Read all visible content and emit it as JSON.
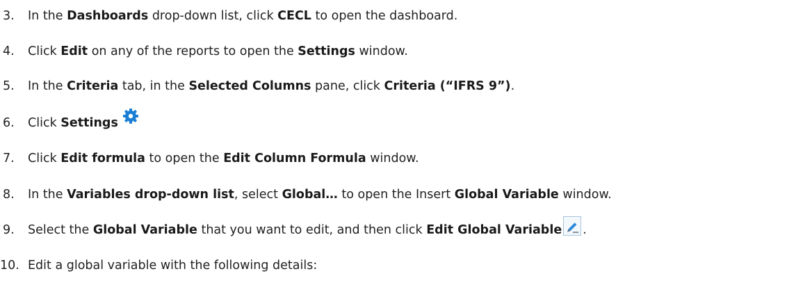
{
  "steps": [
    {
      "num": "3.",
      "parts": [
        {
          "t": "In the "
        },
        {
          "t": "Dashboards",
          "b": true
        },
        {
          "t": " drop-down list, click "
        },
        {
          "t": "CECL",
          "b": true
        },
        {
          "t": " to open the dashboard."
        }
      ]
    },
    {
      "num": "4.",
      "parts": [
        {
          "t": "Click "
        },
        {
          "t": "Edit",
          "b": true
        },
        {
          "t": " on any of the reports to open the "
        },
        {
          "t": "Settings",
          "b": true
        },
        {
          "t": " window."
        }
      ]
    },
    {
      "num": "5.",
      "parts": [
        {
          "t": "In the "
        },
        {
          "t": "Criteria",
          "b": true
        },
        {
          "t": " tab, in the "
        },
        {
          "t": "Selected Columns",
          "b": true
        },
        {
          "t": " pane, click "
        },
        {
          "t": "Criteria (“IFRS 9”)",
          "b": true
        },
        {
          "t": "."
        }
      ]
    },
    {
      "num": "6.",
      "parts": [
        {
          "t": "Click "
        },
        {
          "t": "Settings",
          "b": true
        }
      ],
      "icon": "gear-icon"
    },
    {
      "num": "7.",
      "parts": [
        {
          "t": "Click "
        },
        {
          "t": "Edit formula",
          "b": true
        },
        {
          "t": " to open the "
        },
        {
          "t": "Edit Column Formula",
          "b": true
        },
        {
          "t": " window."
        }
      ]
    },
    {
      "num": "8.",
      "parts": [
        {
          "t": "In the "
        },
        {
          "t": "Variables drop-down list",
          "b": true
        },
        {
          "t": ", select "
        },
        {
          "t": "Global…",
          "b": true
        },
        {
          "t": " to open the Insert "
        },
        {
          "t": "Global Variable",
          "b": true
        },
        {
          "t": " window."
        }
      ]
    },
    {
      "num": "9.",
      "parts": [
        {
          "t": "Select the "
        },
        {
          "t": "Global Variable",
          "b": true
        },
        {
          "t": " that you want to edit, and then click "
        },
        {
          "t": "Edit Global Variable",
          "b": true
        }
      ],
      "icon": "pencil-icon",
      "after": "."
    },
    {
      "num": "10.",
      "parts": [
        {
          "t": "Edit a global variable with the following details:"
        }
      ]
    }
  ],
  "colors": {
    "text": "#1f1f1f",
    "gear": "#1a7fd4",
    "pencil": "#2a8ad8",
    "icon_border": "#a8c4dc"
  }
}
